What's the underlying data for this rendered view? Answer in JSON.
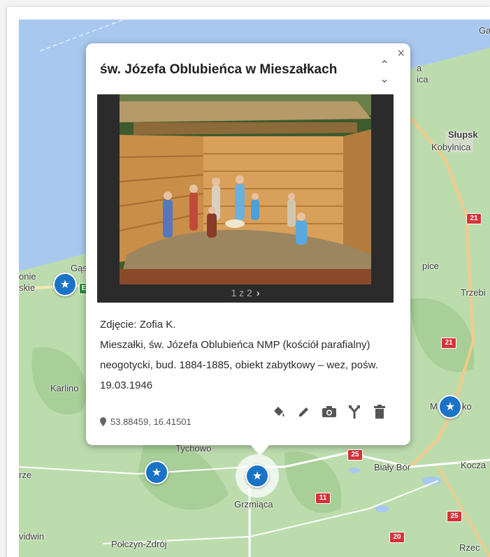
{
  "popup": {
    "title": "św. Józefa Oblubieńca w Mieszałkach",
    "close_glyph": "×",
    "scroll_up": "⌃",
    "scroll_down": "⌄",
    "pager": "1 z 2",
    "pager_next": "›",
    "photo_credit": "Zdjęcie: Zofia K.",
    "description": "Mieszałki, św. Józefa Oblubieńca NMP (kościół parafialny) neogotycki, bud. 1884-1885, obiekt zabytkowy – wez, pośw. 19.03.1946",
    "coordinates": "53.88459, 16.41501",
    "actions": [
      "paint-bucket-icon",
      "pencil-icon",
      "camera-icon",
      "route-icon",
      "trash-icon"
    ]
  },
  "map": {
    "labels": {
      "gdansk_edge": "Ga",
      "a_edge": "a",
      "ica": "ica",
      "slupsk": "Słupsk",
      "kobylnica": "Kobylnica",
      "onie": "onie",
      "skie": "skie",
      "gask": "Gąsk",
      "pice": "pice",
      "trzebi": "Trzebi",
      "karlino": "Karlino",
      "b": "B",
      "mo": "M",
      "ko": "ko",
      "rze": "rze",
      "tychowo": "Tychowo",
      "bialy_bor": "Biały Bór",
      "kocza": "Kocza",
      "grzmiaca": "Grzmiąca",
      "vidwin": "vidwin",
      "polczyn": "Połczyn-Zdrój",
      "rzec": "Rzec"
    },
    "shields": {
      "s21a": "21",
      "s21b": "21",
      "s25a": "25",
      "s25b": "25",
      "s11": "11",
      "s20": "20",
      "e": "E"
    }
  },
  "colors": {
    "water": "#a9c8ef",
    "land": "#bcdcae",
    "pin": "#1a73c6",
    "road_shield": "#d5333a"
  }
}
